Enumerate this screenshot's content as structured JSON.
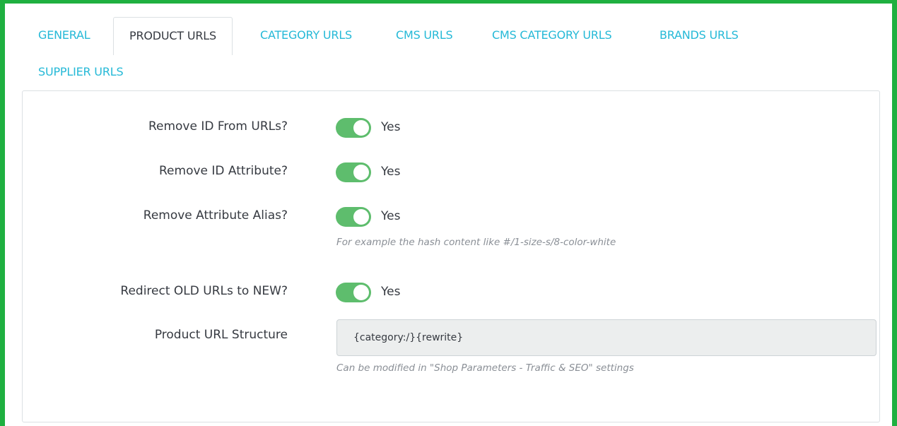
{
  "tabs": [
    {
      "label": "GENERAL"
    },
    {
      "label": "PRODUCT URLS",
      "active": true
    },
    {
      "label": "CATEGORY URLS"
    },
    {
      "label": "CMS URLS"
    },
    {
      "label": "CMS CATEGORY URLS"
    },
    {
      "label": "BRANDS URLS"
    },
    {
      "label": "SUPPLIER URLS"
    }
  ],
  "settings": {
    "remove_id_urls": {
      "label": "Remove ID From URLs?",
      "value": "Yes",
      "enabled": true
    },
    "remove_id_attribute": {
      "label": "Remove ID Attribute?",
      "value": "Yes",
      "enabled": true
    },
    "remove_attribute_alias": {
      "label": "Remove Attribute Alias?",
      "value": "Yes",
      "enabled": true,
      "help": "For example the hash content like #/1-size-s/8-color-white"
    },
    "redirect_old_urls": {
      "label": "Redirect OLD URLs to NEW?",
      "value": "Yes",
      "enabled": true
    },
    "product_url_structure": {
      "label": "Product URL Structure",
      "value": "{category:/}{rewrite}",
      "help": "Can be modified in \"Shop Parameters - Traffic & SEO\" settings"
    }
  },
  "colors": {
    "frame_border": "#1fb040",
    "tab_link": "#25b9d7",
    "switch_on": "#5ebd6d",
    "field_bg": "#eceeee"
  }
}
